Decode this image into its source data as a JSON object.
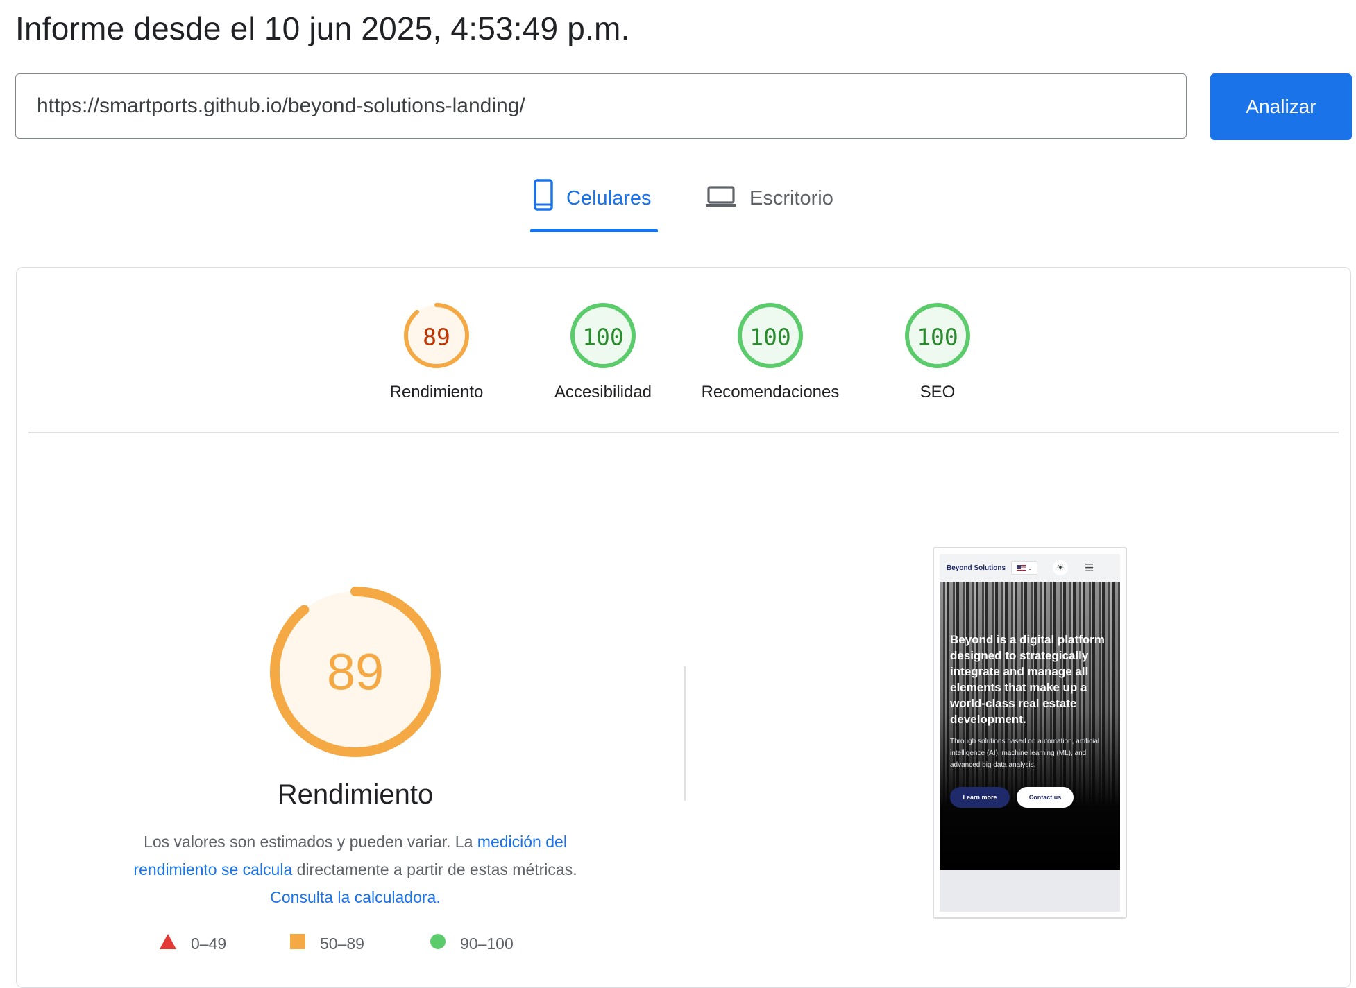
{
  "header": {
    "title": "Informe desde el 10 jun 2025, 4:53:49 p.m."
  },
  "url_bar": {
    "value": "https://smartports.github.io/beyond-solutions-landing/",
    "analyze_label": "Analizar"
  },
  "tabs": [
    {
      "label": "Celulares",
      "icon": "smartphone-icon",
      "selected": true
    },
    {
      "label": "Escritorio",
      "icon": "laptop-icon",
      "selected": false
    }
  ],
  "scores": [
    {
      "label": "Rendimiento",
      "score": "89",
      "value": 89,
      "status": "average"
    },
    {
      "label": "Accesibilidad",
      "score": "100",
      "value": 100,
      "status": "pass"
    },
    {
      "label": "Recomendaciones",
      "score": "100",
      "value": 100,
      "status": "pass"
    },
    {
      "label": "SEO",
      "score": "100",
      "value": 100,
      "status": "pass"
    }
  ],
  "performance": {
    "score": "89",
    "value": 89,
    "title": "Rendimiento",
    "desc_part1": "Los valores son estimados y pueden variar. La ",
    "desc_link1": "medición del rendimiento se calcula",
    "desc_part2": " directamente a partir de estas métricas. ",
    "desc_link2": "Consulta la calculadora."
  },
  "legend": [
    {
      "range": "0–49",
      "shape": "triangle",
      "color": "#e53935"
    },
    {
      "range": "50–89",
      "shape": "square",
      "color": "#f4a944"
    },
    {
      "range": "90–100",
      "shape": "circle",
      "color": "#5ccb6c"
    }
  ],
  "colors": {
    "accent": "#1a73e8",
    "average": "#f4a944",
    "average_text": "#c33300",
    "average_bg": "#fff6ec",
    "pass": "#5ccb6c",
    "pass_text": "#2a8c2e",
    "pass_bg": "#eefaf0"
  },
  "screenshot": {
    "brand": "Beyond Solutions",
    "headline": "Beyond is a digital platform designed to strategically integrate and manage all elements that make up a world-class real estate development.",
    "subtext": "Through solutions based on automation, artificial intelligence (AI), machine learning (ML), and advanced big data analysis.",
    "primary_button": "Learn more",
    "secondary_button": "Contact us"
  }
}
